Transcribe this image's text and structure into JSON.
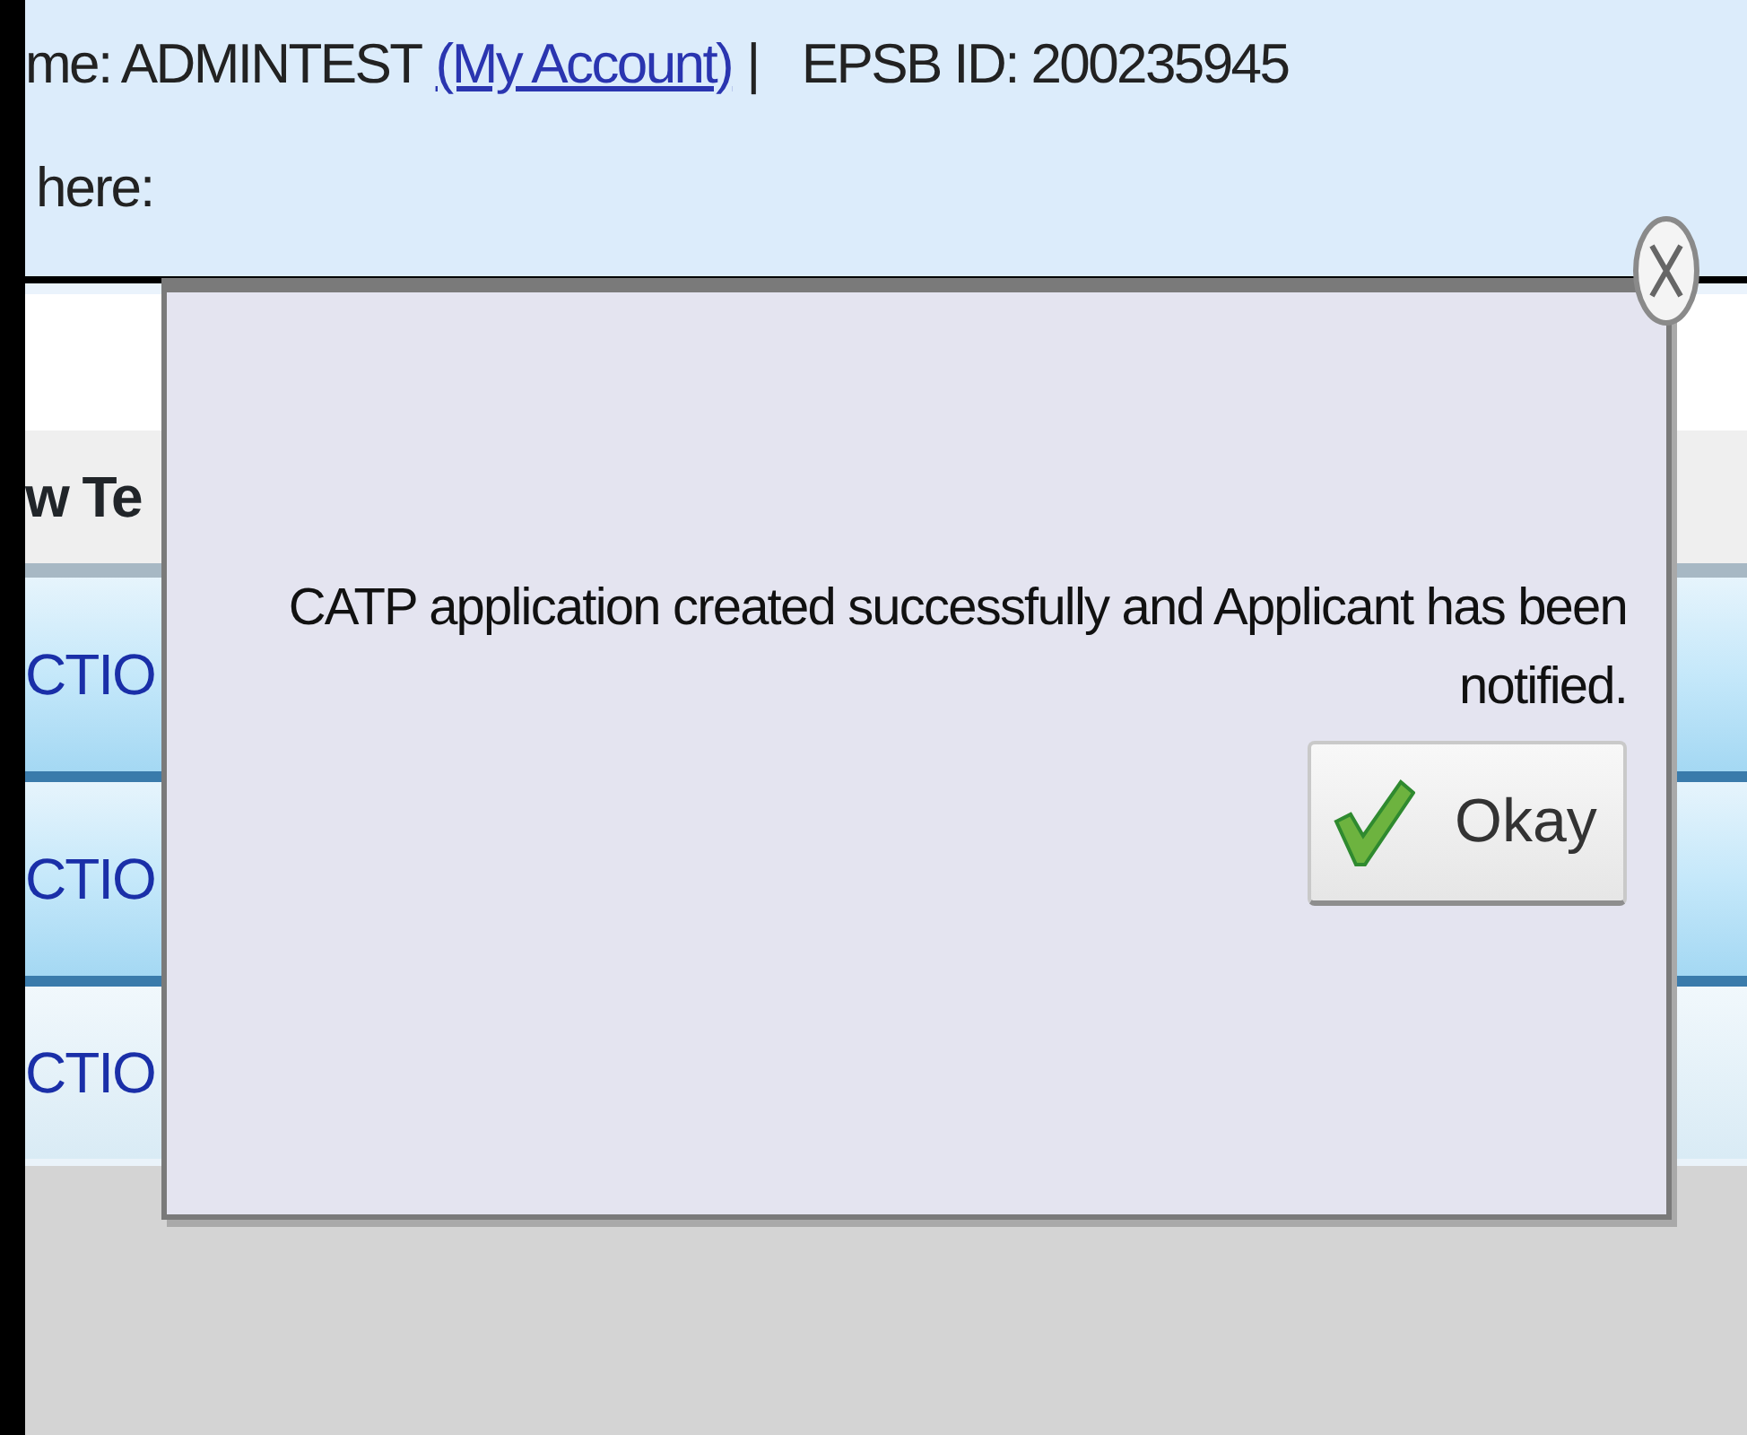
{
  "header": {
    "user": "me: ADMINTEST",
    "account_link": "(My Account)",
    "separator": "|",
    "epsb_id": "EPSB ID: 200235945",
    "prompt": "here:"
  },
  "table": {
    "column_1": "w Te",
    "rows": [
      {
        "cell": "CTIO",
        "highlighted": true
      },
      {
        "cell": "CTIO",
        "highlighted": true
      },
      {
        "cell": "CTIO",
        "highlighted": false
      }
    ]
  },
  "dialog": {
    "message": "CATP application created successfully and Applicant has been notified.",
    "button": "Okay"
  }
}
